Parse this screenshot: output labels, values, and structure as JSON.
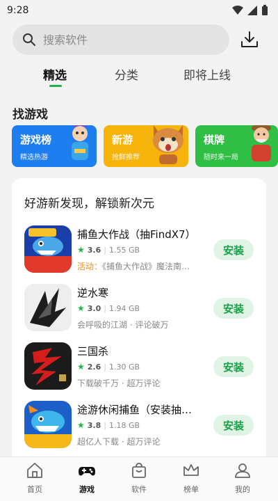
{
  "status": {
    "time": "9:28"
  },
  "search": {
    "placeholder": "搜索软件"
  },
  "tabs": [
    {
      "label": "精选"
    },
    {
      "label": "分类"
    },
    {
      "label": "即将上线"
    }
  ],
  "section": {
    "title": "找游戏"
  },
  "categories": [
    {
      "title": "游戏榜",
      "subtitle": "精选热游",
      "color": "#1e7ef0"
    },
    {
      "title": "新游",
      "subtitle": "抢鲜推荐",
      "color": "#f6b30c"
    },
    {
      "title": "棋牌",
      "subtitle": "随时来一局",
      "color": "#2fbf45"
    }
  ],
  "card": {
    "title": "好游新发现，解锁新次元",
    "apps": [
      {
        "name": "捕鱼大作战（抽FindX7）",
        "rating": "3.6",
        "size": "1.55 GB",
        "desc_prefix": "活动：",
        "desc": "《捕鱼大作战》魔法南…",
        "install": "安装"
      },
      {
        "name": "逆水寒",
        "rating": "3.0",
        "size": "1.94 GB",
        "desc": "会呼吸的江湖 · 评论破万",
        "install": "安装"
      },
      {
        "name": "三国杀",
        "rating": "2.6",
        "size": "1.30 GB",
        "desc": "下载破千万 · 超万评论",
        "install": "安装"
      },
      {
        "name": "途游休闲捕鱼（安装抽…",
        "rating": "3.8",
        "size": "1.18 GB",
        "desc": "超亿人下载 · 超万评论",
        "install": "安装"
      }
    ]
  },
  "nav": [
    {
      "label": "首页"
    },
    {
      "label": "游戏"
    },
    {
      "label": "软件"
    },
    {
      "label": "榜单"
    },
    {
      "label": "我的"
    }
  ],
  "colors": {
    "accent": "#22b14c",
    "install_bg": "#e0f4e6",
    "activity": "#f28c1b"
  }
}
